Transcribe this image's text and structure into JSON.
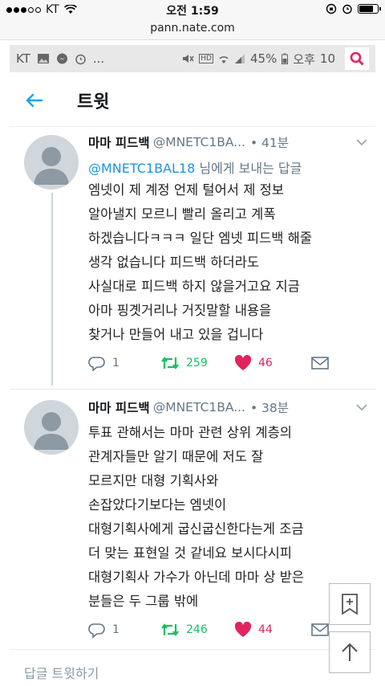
{
  "ios_status": {
    "carrier": "KT",
    "time": "오전 1:59",
    "signal_dots": 5,
    "battery_level": 0.75
  },
  "browser": {
    "url": "pann.nate.com"
  },
  "android_status": {
    "carrier": "KT",
    "battery_percent": "45%",
    "ampm": "오후",
    "time": "10"
  },
  "header": {
    "title": "트윗"
  },
  "tweets": [
    {
      "name": "마마 피드백",
      "handle": "@MNETC1BA...",
      "time": "• 41분",
      "reply_prefix": "",
      "reply_mention": "@MNETC1BAL18",
      "reply_suffix": " 님에게 보내는 답글",
      "text": "엠넷이 제 계정 언제 털어서 제 정보\n알아낼지 모르니 빨리 올리고 계폭\n하겠습니다ㅋㅋㅋ 일단 엠넷 피드백 해줄\n생각 없습니다 피드백 하더라도\n사실대로 피드백 하지 않을거고요 지금\n아마 핑곗거리나 거짓말할 내용을\n찾거나 만들어 내고 있을 겁니다",
      "replies": "1",
      "retweets": "259",
      "likes": "46"
    },
    {
      "name": "마마 피드백",
      "handle": "@MNETC1BA...",
      "time": "• 38분",
      "text": "투표 관해서는 마마 관련 상위 계층의\n관계자들만 알기 때문에 저도 잘\n모르지만 대형 기획사와\n손잡았다기보다는 엠넷이\n대형기획사에게 굽신굽신한다는게 조금\n더 맞는 표현일 것 같네요 보시다시피\n대형기획사 가수가 아닌데 마마 상 받은\n분들은 두 그룹 밖에",
      "replies": "1",
      "retweets": "246",
      "likes": "44"
    }
  ],
  "reply_bar": {
    "placeholder": "답글 트윗하기"
  },
  "colors": {
    "retweet": "#17bf63",
    "like": "#e0245e",
    "link": "#1b95e0",
    "accent": "#1da1f2"
  }
}
